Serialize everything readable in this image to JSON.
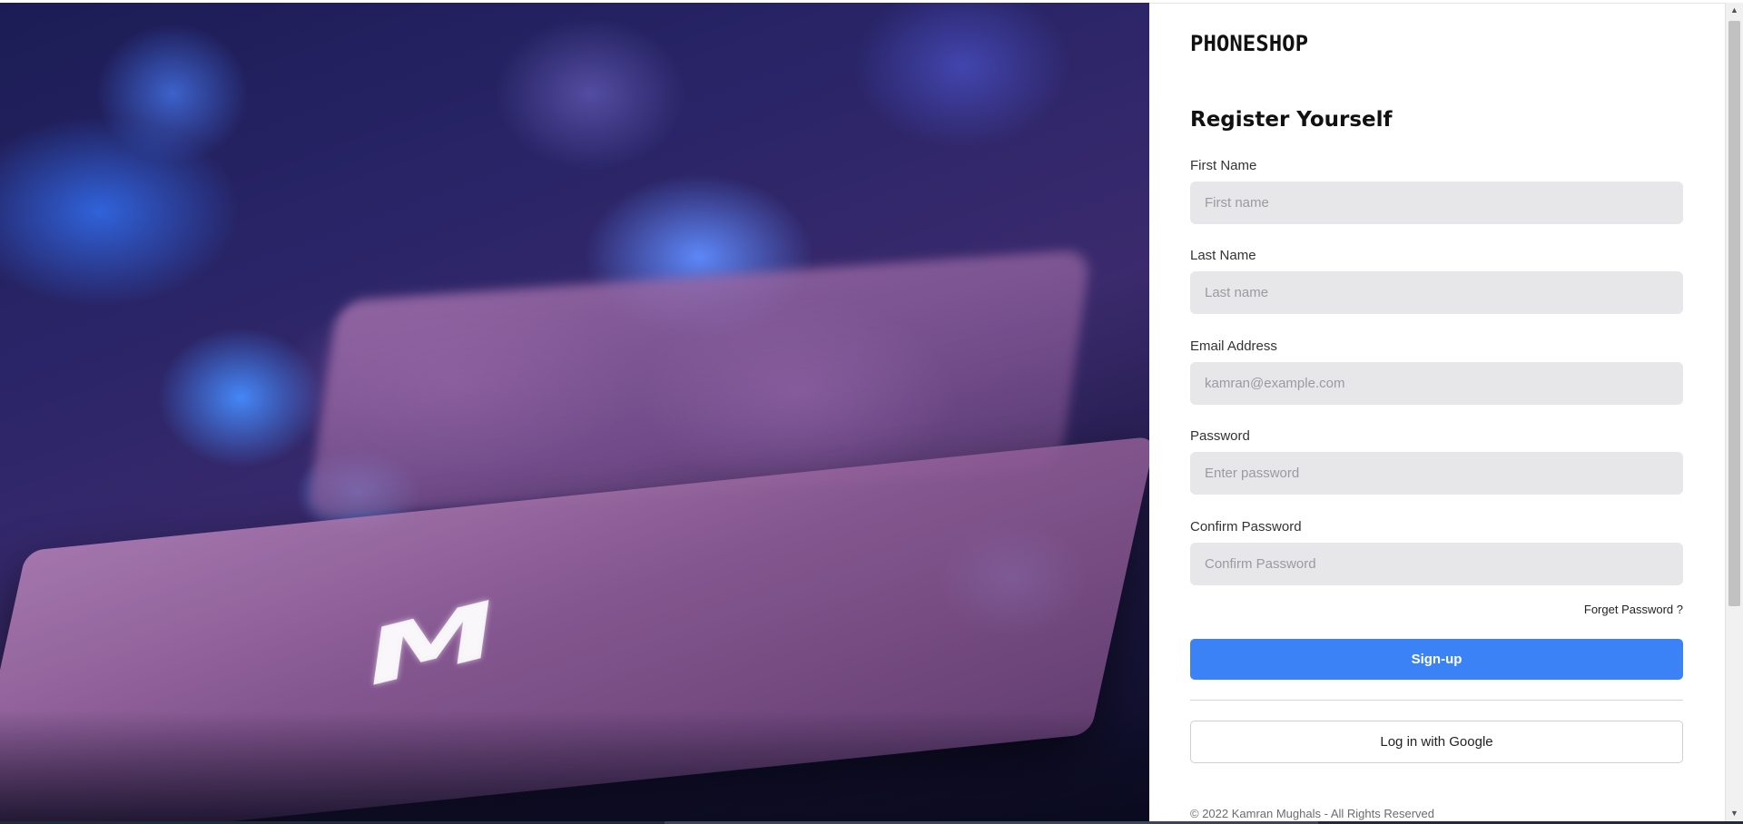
{
  "brand": "PHONESHOP",
  "hero": {
    "key_letter": "M"
  },
  "form": {
    "title": "Register Yourself",
    "fields": [
      {
        "label": "First Name",
        "placeholder": "First name",
        "value": ""
      },
      {
        "label": "Last Name",
        "placeholder": "Last name",
        "value": ""
      },
      {
        "label": "Email Address",
        "placeholder": "kamran@example.com",
        "value": ""
      },
      {
        "label": "Password",
        "placeholder": "Enter password",
        "value": ""
      },
      {
        "label": "Confirm Password",
        "placeholder": "Confirm Password",
        "value": ""
      }
    ],
    "forget_link": "Forget Password ?",
    "signup_label": "Sign-up",
    "google_label": "Log in with Google"
  },
  "footer": "© 2022 Kamran Mughals - All Rights Reserved",
  "colors": {
    "primary": "#3b82f6",
    "input_bg": "#e7e7ea",
    "text_dark": "#111111"
  },
  "icons": {
    "scroll_up": "scroll-up-arrow-icon",
    "scroll_down": "scroll-down-arrow-icon"
  }
}
